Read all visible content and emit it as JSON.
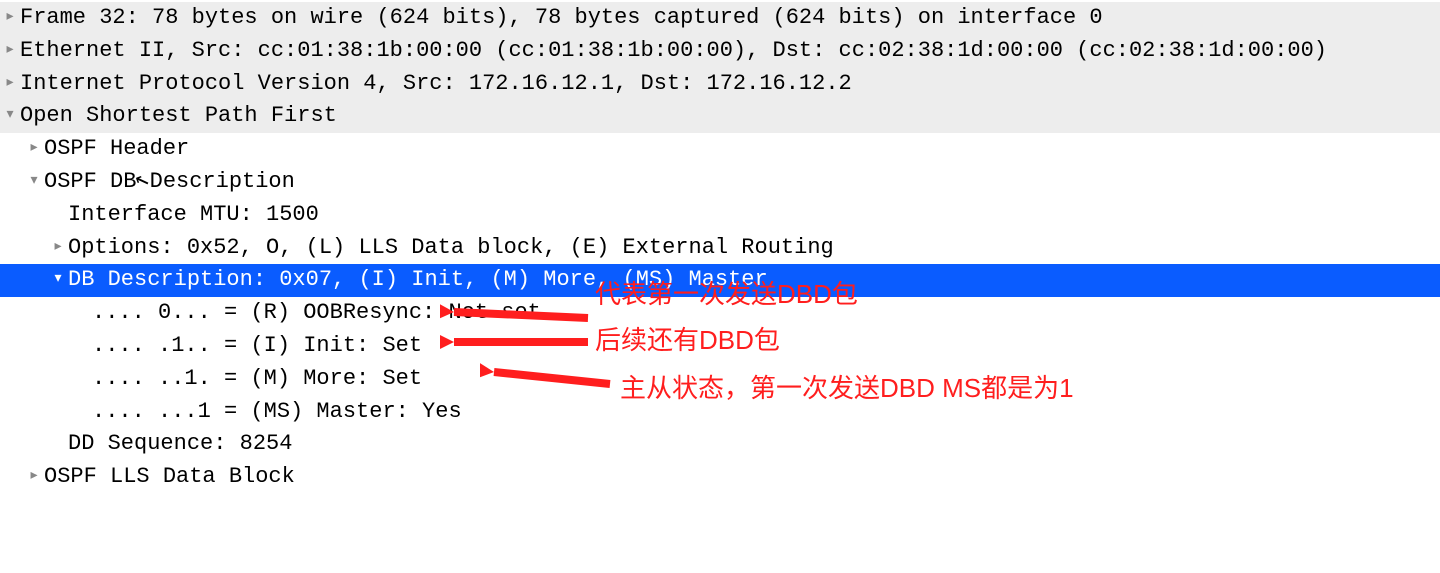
{
  "rows": {
    "frame": "Frame 32: 78 bytes on wire (624 bits), 78 bytes captured (624 bits) on interface 0",
    "ethernet": "Ethernet II, Src: cc:01:38:1b:00:00 (cc:01:38:1b:00:00), Dst: cc:02:38:1d:00:00 (cc:02:38:1d:00:00)",
    "ip": "Internet Protocol Version 4, Src: 172.16.12.1, Dst: 172.16.12.2",
    "ospf": "Open Shortest Path First",
    "ospf_header": "OSPF Header",
    "ospf_dbd": "OSPF DB Description",
    "mtu": "Interface MTU: 1500",
    "options": "Options: 0x52, O, (L) LLS Data block, (E) External Routing",
    "dbdesc": "DB Description: 0x07, (I) Init, (M) More, (MS) Master",
    "flag_r": ".... 0... = (R) OOBResync: Not set",
    "flag_i": ".... .1.. = (I) Init: Set",
    "flag_m": ".... ..1. = (M) More: Set",
    "flag_ms": ".... ...1 = (MS) Master: Yes",
    "dd_seq": "DD Sequence: 8254",
    "ospf_lls": "OSPF LLS Data Block"
  },
  "annotations": {
    "a1": "代表第一次发送DBD包",
    "a2": "后续还有DBD包",
    "a3": "主从状态，第一次发送DBD MS都是为1"
  },
  "glyphs": {
    "right": "▸",
    "down": "▾"
  }
}
